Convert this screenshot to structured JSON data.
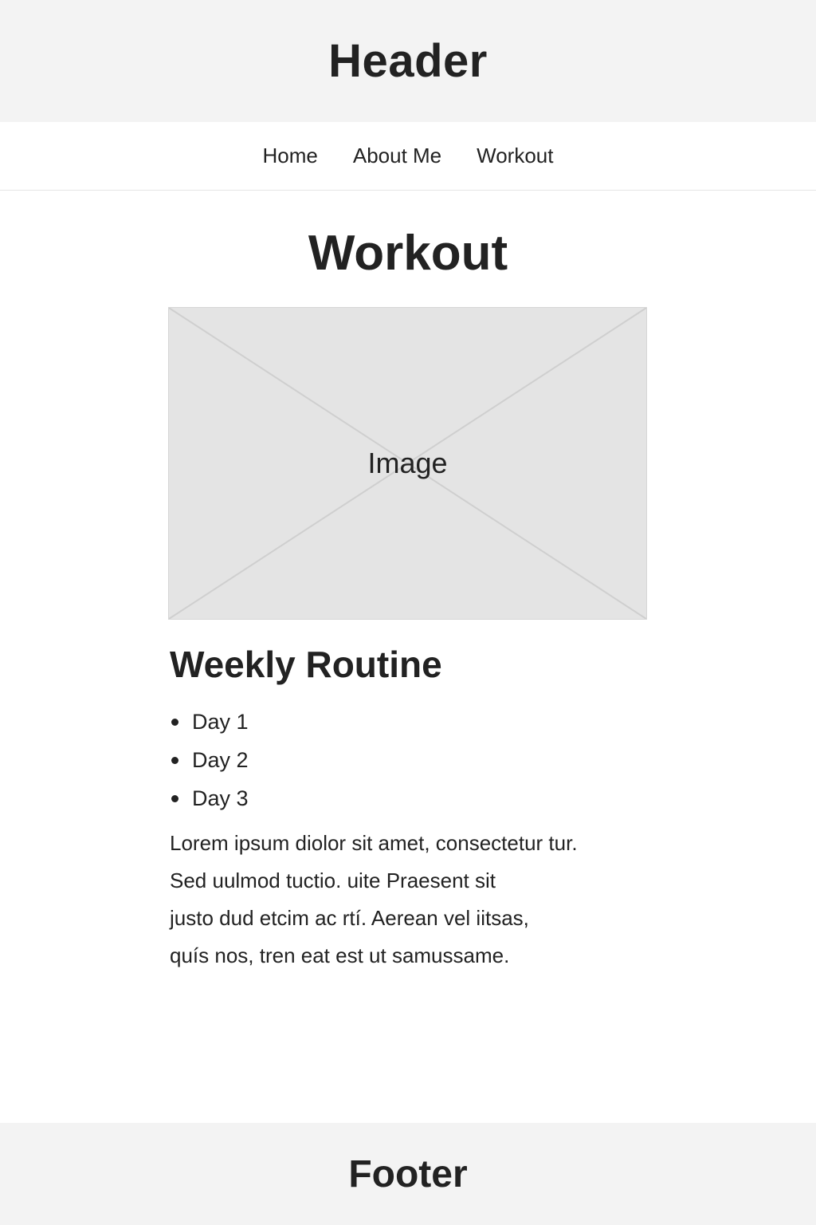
{
  "header": {
    "title": "Header"
  },
  "nav": {
    "items": [
      {
        "label": "Home"
      },
      {
        "label": "About Me"
      },
      {
        "label": "Workout"
      }
    ]
  },
  "main": {
    "title": "Workout",
    "image": {
      "label": "Image"
    },
    "section_title": "Weekly Routine",
    "routine": [
      {
        "label": "Day 1"
      },
      {
        "label": "Day 2"
      },
      {
        "label": "Day 3"
      }
    ],
    "paragraph_lines": [
      "Lorem ipsum diolor sit amet, consectetur tur.",
      "Sed uulmod tuctio. uite Praesent sit",
      "justo dud etcim ac rtí. Aerean vel iitsas,",
      "quís nos, tren eat est ut samussame."
    ]
  },
  "footer": {
    "title": "Footer"
  }
}
